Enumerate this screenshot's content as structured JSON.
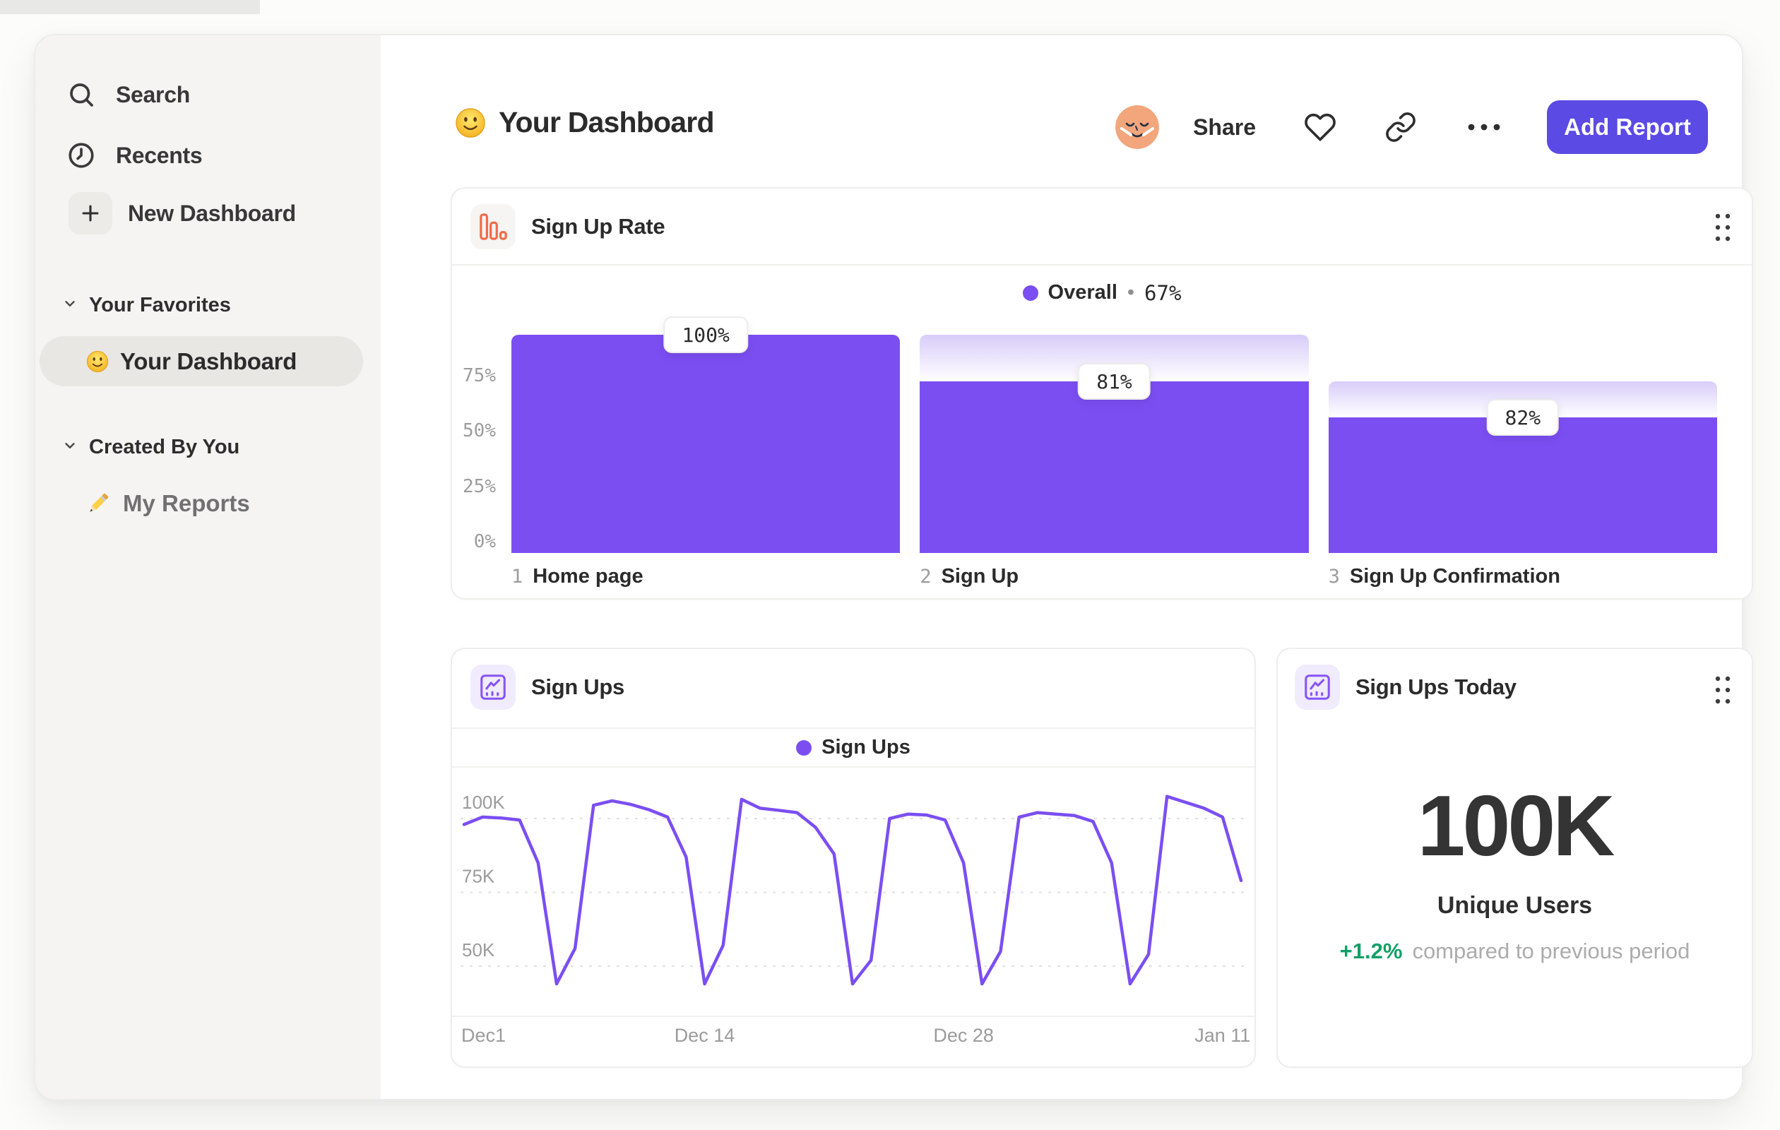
{
  "sidebar": {
    "search": "Search",
    "recents": "Recents",
    "new_dashboard": "New Dashboard",
    "favorites_header": "Your Favorites",
    "favorite_item": "Your Dashboard",
    "created_header": "Created By You",
    "created_item": "My Reports"
  },
  "header": {
    "title": "Your Dashboard",
    "share": "Share",
    "add_report": "Add Report"
  },
  "cards": {
    "funnel": {
      "title": "Sign Up Rate"
    },
    "line": {
      "title": "Sign Ups"
    },
    "today": {
      "title": "Sign Ups Today",
      "value": "100K",
      "value_label": "Unique Users",
      "change": "+1.2%",
      "change_note": "compared to previous period"
    }
  },
  "colors": {
    "accent_purple": "#7B4EF2",
    "button_purple": "#5B4AE4",
    "icon_orange": "#F26B4A",
    "icon_purple": "#8655F6",
    "positive_green": "#12A066"
  },
  "chart_data": [
    {
      "type": "bar",
      "title": "Sign Up Rate",
      "legend": {
        "series": "Overall",
        "sep": "•",
        "value": "67%",
        "position": "top-center"
      },
      "y_ticks": [
        "75%",
        "50%",
        "25%",
        "0%"
      ],
      "ylim": [
        0,
        100
      ],
      "grid": false,
      "steps": [
        {
          "index": "1",
          "label": "Home page",
          "conversion": "100%",
          "display_height_pct": 100,
          "cap_top_pct": null
        },
        {
          "index": "2",
          "label": "Sign Up",
          "conversion": "81%",
          "display_height_pct": 78.6,
          "cap_top_pct": 100
        },
        {
          "index": "3",
          "label": "Sign Up Confirmation",
          "conversion": "82%",
          "display_height_pct": 62,
          "cap_top_pct": 78.6
        }
      ]
    },
    {
      "type": "line",
      "title": "Sign Ups",
      "legend": {
        "series": "Sign Ups",
        "position": "top-center"
      },
      "unit": "K",
      "ylim": [
        33,
        118
      ],
      "grid": "dashed-horizontal",
      "y_ticks": [
        {
          "label": "100K",
          "value": 100
        },
        {
          "label": "75K",
          "value": 75
        },
        {
          "label": "50K",
          "value": 50
        }
      ],
      "x_ticks": [
        {
          "label": "Dec1",
          "day": 0
        },
        {
          "label": "Dec 14",
          "day": 13
        },
        {
          "label": "Dec 28",
          "day": 27
        },
        {
          "label": "Jan 11",
          "day": 41
        }
      ],
      "values": [
        98,
        100.5,
        100.2,
        99.5,
        85,
        44,
        56,
        104.5,
        106,
        104.8,
        103,
        100.5,
        87,
        44,
        57,
        106.5,
        103.5,
        102.8,
        102,
        97,
        88,
        44,
        52,
        100,
        101.5,
        101.2,
        99.5,
        85,
        44,
        55,
        100.5,
        102,
        101.5,
        101,
        99,
        85,
        44,
        54,
        107.5,
        105.5,
        103.5,
        100.5,
        79
      ]
    },
    {
      "type": "kpi",
      "title": "Sign Ups Today",
      "value": "100K",
      "label": "Unique Users",
      "change_pct": "+1.2%",
      "comparison": "compared to previous period"
    }
  ]
}
